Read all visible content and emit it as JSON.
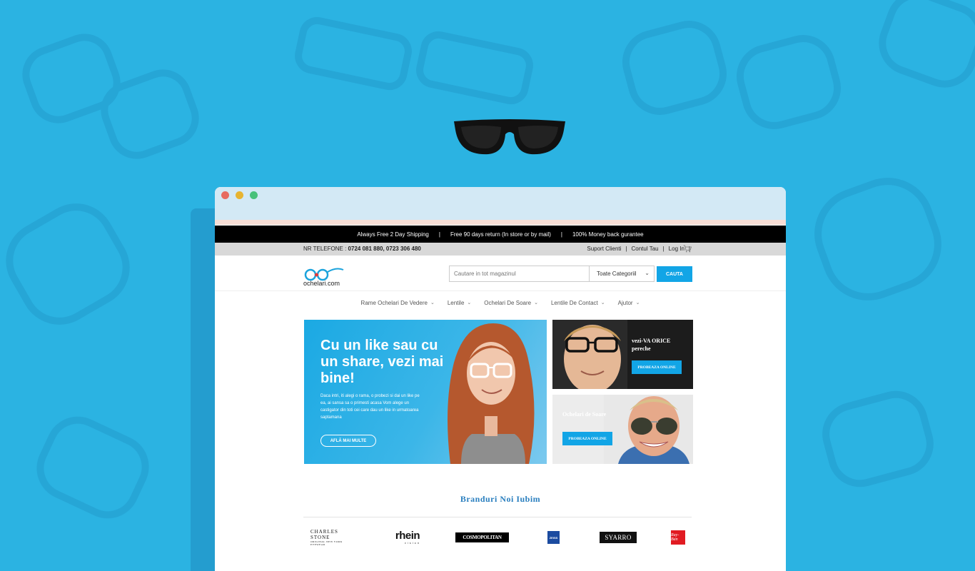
{
  "colors": {
    "background": "#2bb3e2",
    "accent": "#12a5e6",
    "promo_bar": "#000000",
    "info_bar": "#d8d8d8",
    "brand_title": "#2a7fbf"
  },
  "promo": {
    "item1": "Always Free 2 Day Shipping",
    "item2": "Free 90 days return (In store or by mail)",
    "item3": "100% Money back gurantee",
    "separator": "|"
  },
  "info": {
    "phone_label": "NR TELEFONE :",
    "phone_numbers": "0724 081 880, 0723 306 480",
    "support": "Suport Clienti",
    "account": "Contul Tau",
    "login": "Log In",
    "separator": "|"
  },
  "header": {
    "logo_text": "ochelari.com",
    "search_placeholder": "Cautare in tot magazinul",
    "category": "Toate Categoriil",
    "search_button": "CAUTA"
  },
  "nav": {
    "items": [
      {
        "label": "Rame Ochelari De Vedere"
      },
      {
        "label": "Lentile"
      },
      {
        "label": "Ochelari De Soare"
      },
      {
        "label": "Lentile De Contact"
      },
      {
        "label": "Ajutor"
      }
    ]
  },
  "banner": {
    "title": "Cu un like sau cu un share, vezi mai bine!",
    "text": "Daca intri, iti alegi o rama, o probezi si dai un like pe ea, ai sansa sa o primesti acasa Vom alege un castigator din toti cei care dau un like in urmatoarea saptamana",
    "button": "AFLĂ MAI MULTE"
  },
  "tiles": {
    "tile1": {
      "title": "vezi-VA ORICE pereche",
      "button": "PROBEAZA ONLINE"
    },
    "tile2": {
      "title": "Ochelari de Soare",
      "button": "PROBEAZA ONLINE"
    }
  },
  "brands": {
    "title": "Branduri Noi Iubim",
    "charles_stone": "CHARLES STONE",
    "charles_stone_sub": "ORIGINAL NEW YORK EYEWEAR",
    "rhein": "rhein",
    "rhein_sub": "vision",
    "cosmopolitan": "COSMOPOLITAN",
    "zeiss": "ZEISS",
    "syarro": "SYARRO",
    "rayban": "Ray-Ban"
  }
}
